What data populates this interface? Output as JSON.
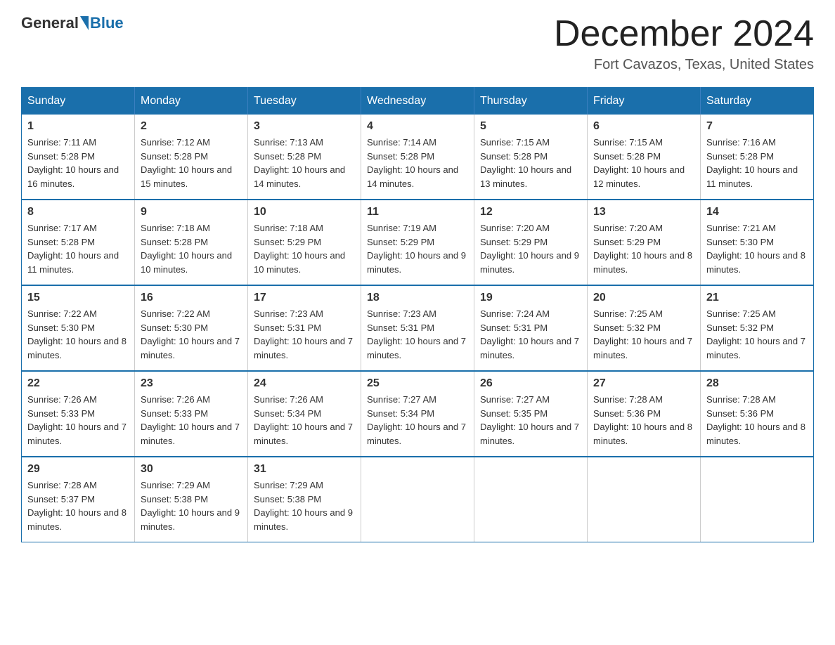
{
  "logo": {
    "general": "General",
    "blue": "Blue"
  },
  "title": "December 2024",
  "location": "Fort Cavazos, Texas, United States",
  "days_of_week": [
    "Sunday",
    "Monday",
    "Tuesday",
    "Wednesday",
    "Thursday",
    "Friday",
    "Saturday"
  ],
  "weeks": [
    [
      {
        "day": "1",
        "sunrise": "7:11 AM",
        "sunset": "5:28 PM",
        "daylight": "10 hours and 16 minutes."
      },
      {
        "day": "2",
        "sunrise": "7:12 AM",
        "sunset": "5:28 PM",
        "daylight": "10 hours and 15 minutes."
      },
      {
        "day": "3",
        "sunrise": "7:13 AM",
        "sunset": "5:28 PM",
        "daylight": "10 hours and 14 minutes."
      },
      {
        "day": "4",
        "sunrise": "7:14 AM",
        "sunset": "5:28 PM",
        "daylight": "10 hours and 14 minutes."
      },
      {
        "day": "5",
        "sunrise": "7:15 AM",
        "sunset": "5:28 PM",
        "daylight": "10 hours and 13 minutes."
      },
      {
        "day": "6",
        "sunrise": "7:15 AM",
        "sunset": "5:28 PM",
        "daylight": "10 hours and 12 minutes."
      },
      {
        "day": "7",
        "sunrise": "7:16 AM",
        "sunset": "5:28 PM",
        "daylight": "10 hours and 11 minutes."
      }
    ],
    [
      {
        "day": "8",
        "sunrise": "7:17 AM",
        "sunset": "5:28 PM",
        "daylight": "10 hours and 11 minutes."
      },
      {
        "day": "9",
        "sunrise": "7:18 AM",
        "sunset": "5:28 PM",
        "daylight": "10 hours and 10 minutes."
      },
      {
        "day": "10",
        "sunrise": "7:18 AM",
        "sunset": "5:29 PM",
        "daylight": "10 hours and 10 minutes."
      },
      {
        "day": "11",
        "sunrise": "7:19 AM",
        "sunset": "5:29 PM",
        "daylight": "10 hours and 9 minutes."
      },
      {
        "day": "12",
        "sunrise": "7:20 AM",
        "sunset": "5:29 PM",
        "daylight": "10 hours and 9 minutes."
      },
      {
        "day": "13",
        "sunrise": "7:20 AM",
        "sunset": "5:29 PM",
        "daylight": "10 hours and 8 minutes."
      },
      {
        "day": "14",
        "sunrise": "7:21 AM",
        "sunset": "5:30 PM",
        "daylight": "10 hours and 8 minutes."
      }
    ],
    [
      {
        "day": "15",
        "sunrise": "7:22 AM",
        "sunset": "5:30 PM",
        "daylight": "10 hours and 8 minutes."
      },
      {
        "day": "16",
        "sunrise": "7:22 AM",
        "sunset": "5:30 PM",
        "daylight": "10 hours and 7 minutes."
      },
      {
        "day": "17",
        "sunrise": "7:23 AM",
        "sunset": "5:31 PM",
        "daylight": "10 hours and 7 minutes."
      },
      {
        "day": "18",
        "sunrise": "7:23 AM",
        "sunset": "5:31 PM",
        "daylight": "10 hours and 7 minutes."
      },
      {
        "day": "19",
        "sunrise": "7:24 AM",
        "sunset": "5:31 PM",
        "daylight": "10 hours and 7 minutes."
      },
      {
        "day": "20",
        "sunrise": "7:25 AM",
        "sunset": "5:32 PM",
        "daylight": "10 hours and 7 minutes."
      },
      {
        "day": "21",
        "sunrise": "7:25 AM",
        "sunset": "5:32 PM",
        "daylight": "10 hours and 7 minutes."
      }
    ],
    [
      {
        "day": "22",
        "sunrise": "7:26 AM",
        "sunset": "5:33 PM",
        "daylight": "10 hours and 7 minutes."
      },
      {
        "day": "23",
        "sunrise": "7:26 AM",
        "sunset": "5:33 PM",
        "daylight": "10 hours and 7 minutes."
      },
      {
        "day": "24",
        "sunrise": "7:26 AM",
        "sunset": "5:34 PM",
        "daylight": "10 hours and 7 minutes."
      },
      {
        "day": "25",
        "sunrise": "7:27 AM",
        "sunset": "5:34 PM",
        "daylight": "10 hours and 7 minutes."
      },
      {
        "day": "26",
        "sunrise": "7:27 AM",
        "sunset": "5:35 PM",
        "daylight": "10 hours and 7 minutes."
      },
      {
        "day": "27",
        "sunrise": "7:28 AM",
        "sunset": "5:36 PM",
        "daylight": "10 hours and 8 minutes."
      },
      {
        "day": "28",
        "sunrise": "7:28 AM",
        "sunset": "5:36 PM",
        "daylight": "10 hours and 8 minutes."
      }
    ],
    [
      {
        "day": "29",
        "sunrise": "7:28 AM",
        "sunset": "5:37 PM",
        "daylight": "10 hours and 8 minutes."
      },
      {
        "day": "30",
        "sunrise": "7:29 AM",
        "sunset": "5:38 PM",
        "daylight": "10 hours and 9 minutes."
      },
      {
        "day": "31",
        "sunrise": "7:29 AM",
        "sunset": "5:38 PM",
        "daylight": "10 hours and 9 minutes."
      },
      null,
      null,
      null,
      null
    ]
  ]
}
